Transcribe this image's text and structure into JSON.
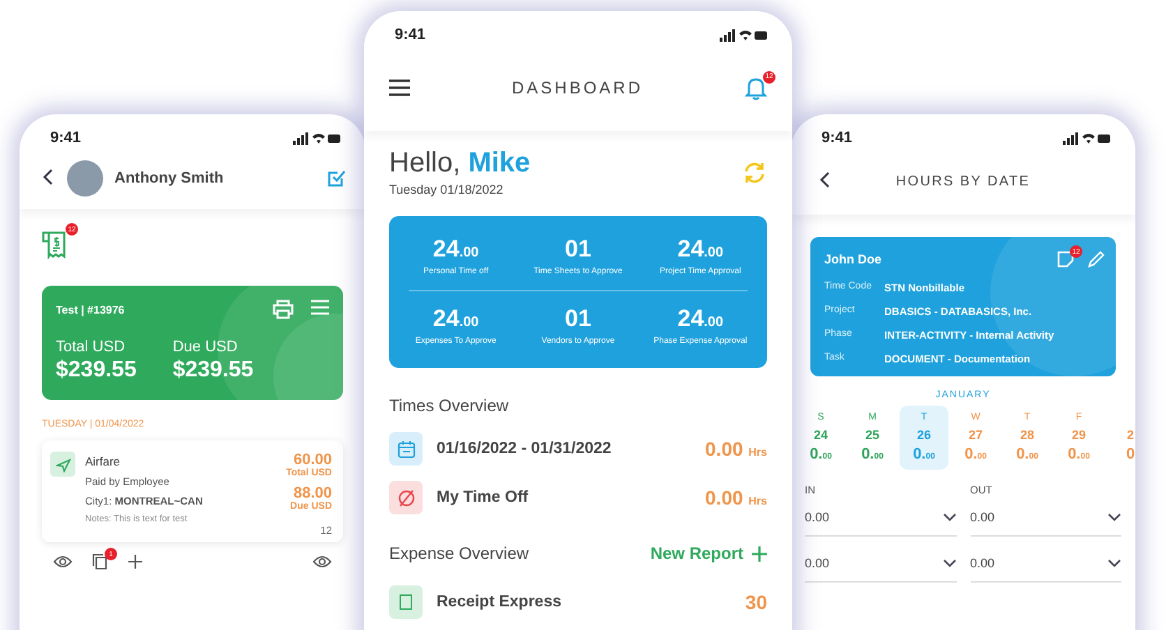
{
  "left_phone": {
    "status_time": "9:41",
    "user_name": "Anthony Smith",
    "receipt_badge": "12",
    "report_card": {
      "title": "Test | #13976",
      "totals": [
        {
          "label": "Total USD",
          "value": "$239.55"
        },
        {
          "label": "Due USD",
          "value": "$239.55"
        }
      ]
    },
    "date_heading": "TUESDAY | 01/04/2022",
    "expense": {
      "category": "Airfare",
      "paid_by": "Paid by Employee",
      "city_label": "City1:",
      "city": "MONTREAL~CAN",
      "notes": "Notes: This is text for test",
      "total": "60.00",
      "total_label": "Total USD",
      "due": "88.00",
      "due_label": "Due USD",
      "count": "12"
    },
    "action_badge": "1"
  },
  "center_phone": {
    "status_time": "9:41",
    "title": "DASHBOARD",
    "notification_badge": "12",
    "greeting": "Hello,",
    "user_name": "Mike",
    "date": "Tuesday 01/18/2022",
    "stats": [
      {
        "value": "24",
        "decimals": ".00",
        "label": "Personal Time off"
      },
      {
        "value": "01",
        "label": "Time Sheets to Approve"
      },
      {
        "value": "24",
        "decimals": ".00",
        "label": "Project Time Approval"
      },
      {
        "value": "24",
        "decimals": ".00",
        "label": "Expenses To Approve"
      },
      {
        "value": "01",
        "label": "Vendors to Approve"
      },
      {
        "value": "24",
        "decimals": ".00",
        "label": "Phase Expense Approval"
      }
    ],
    "times_overview": {
      "title": "Times Overview",
      "rows": [
        {
          "kind": "calendar",
          "label": "01/16/2022 - 01/31/2022",
          "value": "0.00",
          "unit": "Hrs"
        },
        {
          "kind": "time-off",
          "label": "My Time Off",
          "value": "0.00",
          "unit": "Hrs"
        }
      ]
    },
    "expense_overview": {
      "title": "Expense Overview",
      "action": "New Report",
      "rows": [
        {
          "label": "Receipt Express",
          "value": "30"
        }
      ]
    }
  },
  "right_phone": {
    "status_time": "9:41",
    "title": "HOURS BY DATE",
    "card": {
      "name": "John Doe",
      "badge": "12",
      "fields": [
        {
          "label": "Time Code",
          "value": "STN Nonbillable"
        },
        {
          "label": "Project",
          "value": "DBASICS - DATABASICS, Inc."
        },
        {
          "label": "Phase",
          "value": "INTER-ACTIVITY - Internal Activity"
        },
        {
          "label": "Task",
          "value": "DOCUMENT - Documentation"
        }
      ]
    },
    "month": "JANUARY",
    "days": [
      {
        "weekday": "S",
        "date": "24",
        "value": "0.",
        "decimals": "00",
        "kind": "past",
        "selected": false
      },
      {
        "weekday": "M",
        "date": "25",
        "value": "0.",
        "decimals": "00",
        "kind": "past",
        "selected": false
      },
      {
        "weekday": "T",
        "date": "26",
        "value": "0.",
        "decimals": "00",
        "kind": "today",
        "selected": true
      },
      {
        "weekday": "W",
        "date": "27",
        "value": "0.",
        "decimals": "00",
        "kind": "future",
        "selected": false
      },
      {
        "weekday": "T",
        "date": "28",
        "value": "0.",
        "decimals": "00",
        "kind": "future",
        "selected": false
      },
      {
        "weekday": "F",
        "date": "29",
        "value": "0.",
        "decimals": "00",
        "kind": "future",
        "selected": false
      },
      {
        "date": "2",
        "value": "0",
        "kind": "future",
        "selected": false
      }
    ],
    "time_fields": {
      "headers": [
        "IN",
        "OUT"
      ],
      "rows": [
        [
          "0.00",
          "0.00"
        ],
        [
          "0.00",
          "0.00"
        ]
      ]
    }
  }
}
